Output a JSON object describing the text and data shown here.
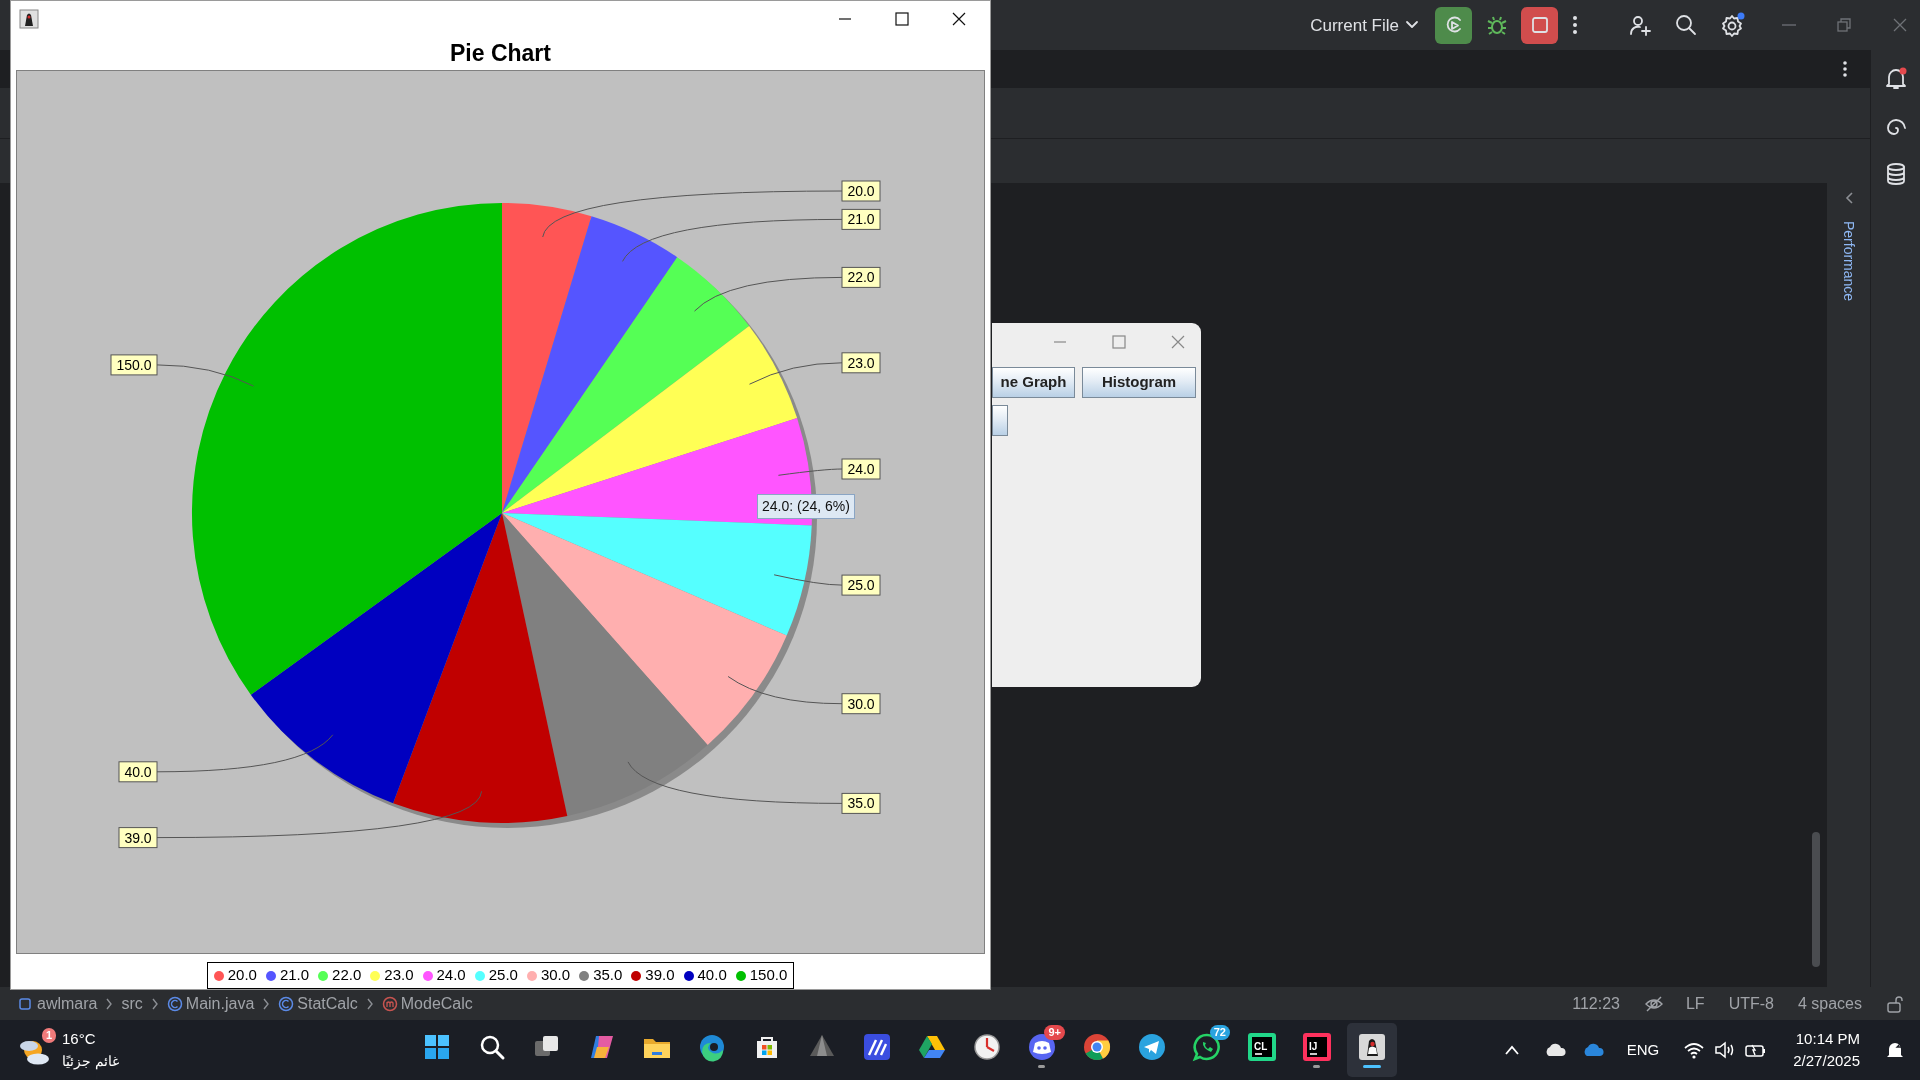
{
  "ide": {
    "run_config": "Current File",
    "side_panel": {
      "title": "Performance"
    },
    "breadcrumbs": [
      {
        "label": "awlmara",
        "kind": "module"
      },
      {
        "label": "src",
        "kind": "folder"
      },
      {
        "label": "Main.java",
        "kind": "file"
      },
      {
        "label": "StatCalc",
        "kind": "class"
      },
      {
        "label": "ModeCalc",
        "kind": "method"
      }
    ],
    "status": {
      "position": "112:23",
      "line_ending": "LF",
      "encoding": "UTF-8",
      "indent": "4 spaces"
    }
  },
  "chart_window": {
    "chart_data": {
      "type": "pie",
      "title": "Pie Chart",
      "categories": [
        "20.0",
        "21.0",
        "22.0",
        "23.0",
        "24.0",
        "25.0",
        "30.0",
        "35.0",
        "39.0",
        "40.0",
        "150.0"
      ],
      "values": [
        20,
        21,
        22,
        23,
        24,
        25,
        30,
        35,
        39,
        40,
        150
      ]
    },
    "tooltip": "24.0: (24, 6%)",
    "legend": [
      {
        "label": "20.0",
        "color": "#ff5555"
      },
      {
        "label": "21.0",
        "color": "#5555ff"
      },
      {
        "label": "22.0",
        "color": "#55ff55"
      },
      {
        "label": "23.0",
        "color": "#ffff55"
      },
      {
        "label": "24.0",
        "color": "#ff55ff"
      },
      {
        "label": "25.0",
        "color": "#55ffff"
      },
      {
        "label": "30.0",
        "color": "#ffafaf"
      },
      {
        "label": "35.0",
        "color": "#808080"
      },
      {
        "label": "39.0",
        "color": "#c00000"
      },
      {
        "label": "40.0",
        "color": "#0000c0"
      },
      {
        "label": "150.0",
        "color": "#00c000"
      }
    ]
  },
  "app_window": {
    "buttons": [
      {
        "label": "ne Graph"
      },
      {
        "label": "Histogram"
      }
    ]
  },
  "taskbar": {
    "weather": {
      "temperature": "16°C",
      "condition": "غائم جزئيًا",
      "badge": "1"
    },
    "apps": [
      {
        "kind": "start",
        "running": false,
        "active": false
      },
      {
        "kind": "search",
        "running": false,
        "active": false
      },
      {
        "kind": "taskview",
        "running": false,
        "active": false
      },
      {
        "kind": "copilot",
        "running": false,
        "active": false
      },
      {
        "kind": "folder",
        "running": false,
        "active": false
      },
      {
        "kind": "edge",
        "running": false,
        "active": false
      },
      {
        "kind": "store",
        "running": false,
        "active": false
      },
      {
        "kind": "prism",
        "running": false,
        "active": false
      },
      {
        "kind": "ai",
        "running": false,
        "active": false
      },
      {
        "kind": "drive",
        "running": false,
        "active": false
      },
      {
        "kind": "clock",
        "running": false,
        "active": false
      },
      {
        "kind": "discord",
        "badge": "9+",
        "running": true,
        "active": false
      },
      {
        "kind": "chrome",
        "running": false,
        "active": false
      },
      {
        "kind": "telegram",
        "running": false,
        "active": false
      },
      {
        "kind": "whatsapp",
        "badge": "72",
        "running": false,
        "active": false
      },
      {
        "kind": "ide",
        "label": "CL",
        "running": false,
        "active": false
      },
      {
        "kind": "ide2",
        "label": "IJ",
        "running": true,
        "active": false
      },
      {
        "kind": "javaapp",
        "running": true,
        "active": true
      }
    ],
    "tray": {
      "language": "ENG",
      "time": "10:14 PM",
      "date": "2/27/2025"
    }
  }
}
